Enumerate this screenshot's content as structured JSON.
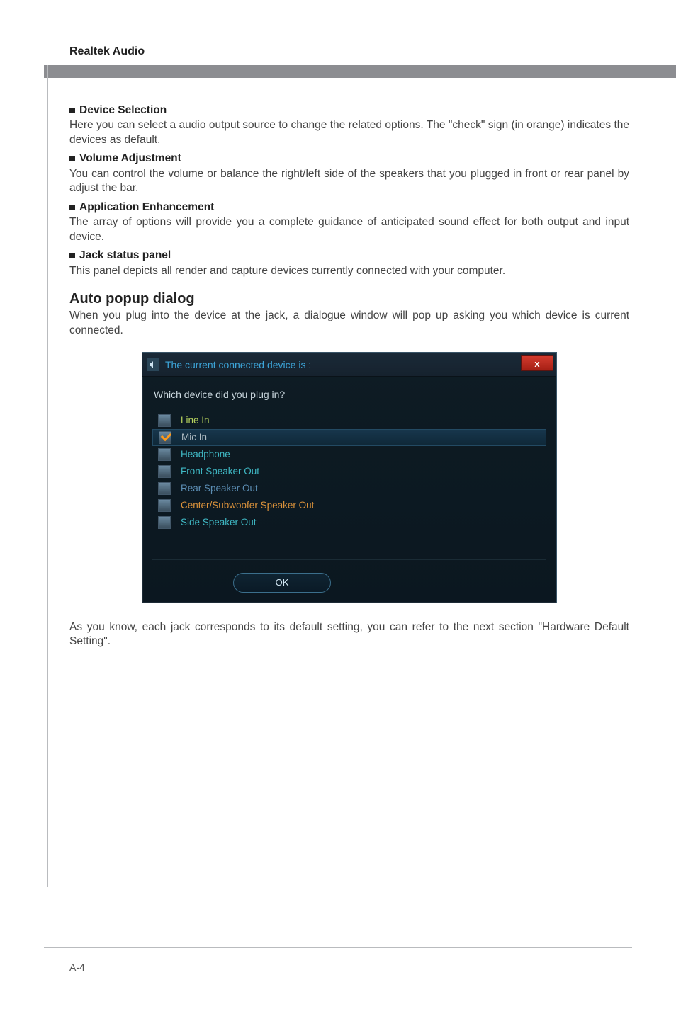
{
  "header": {
    "title": "Realtek Audio"
  },
  "sections": {
    "device_selection": {
      "heading": "Device Selection",
      "body": "Here you can select a audio output source to change the related options. The \"check\" sign (in orange) indicates the devices as default."
    },
    "volume_adjustment": {
      "heading": "Volume Adjustment",
      "body": "You can control the volume or balance the right/left side of the speakers that you plugged in front or rear panel by adjust the bar."
    },
    "application_enhancement": {
      "heading": "Application Enhancement",
      "body": "The array of options will provide you a complete guidance of anticipated sound effect for both output and input device."
    },
    "jack_status": {
      "heading": "Jack status panel",
      "body": "This panel depicts all render and capture devices currently connected with your computer."
    }
  },
  "auto_popup": {
    "heading": "Auto popup dialog",
    "intro": "When you plug into the device at the jack, a dialogue window will pop up asking you which device is current connected.",
    "dialog": {
      "title": "The current connected device is :",
      "close_glyph": "x",
      "prompt": "Which device did you plug in?",
      "options": [
        {
          "label": "Line In",
          "checked": false,
          "selected": false,
          "color": "c-lime"
        },
        {
          "label": "Mic In",
          "checked": true,
          "selected": true,
          "color": "c-gray"
        },
        {
          "label": "Headphone",
          "checked": false,
          "selected": false,
          "color": "c-teal"
        },
        {
          "label": "Front Speaker Out",
          "checked": false,
          "selected": false,
          "color": "c-teal"
        },
        {
          "label": "Rear Speaker Out",
          "checked": false,
          "selected": false,
          "color": "c-lblue"
        },
        {
          "label": "Center/Subwoofer Speaker Out",
          "checked": false,
          "selected": false,
          "color": "c-orange"
        },
        {
          "label": "Side Speaker Out",
          "checked": false,
          "selected": false,
          "color": "c-teal"
        }
      ],
      "ok_label": "OK"
    },
    "outro": "As you know, each jack corresponds to its default setting, you can refer to the next section \"Hardware Default Setting\"."
  },
  "footer": {
    "page": "A-4"
  }
}
